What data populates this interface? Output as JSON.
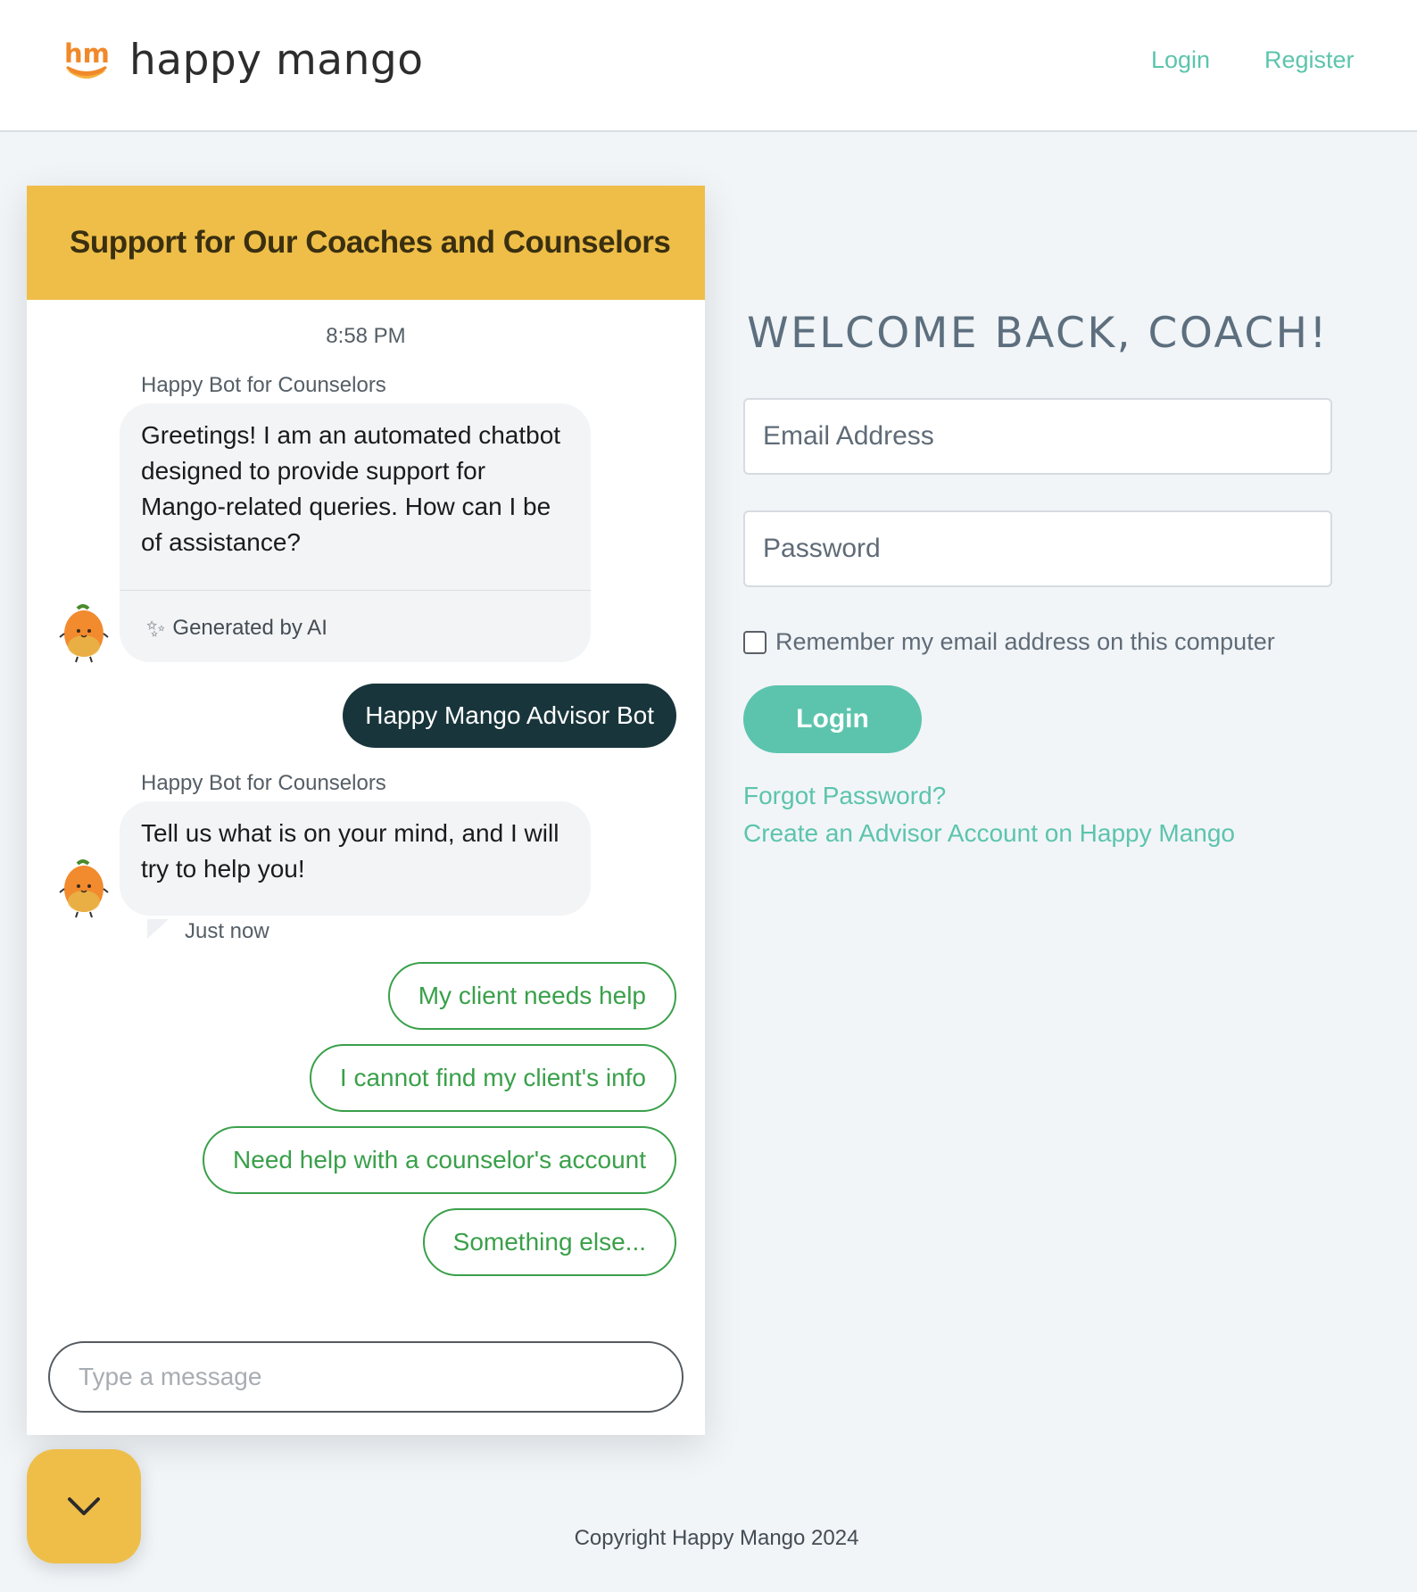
{
  "header": {
    "brand_name": "happy mango",
    "logo_initials": "hm",
    "nav": {
      "login": "Login",
      "register": "Register"
    }
  },
  "chat": {
    "title": "Support for Our Coaches and Counselors",
    "timestamp": "8:58 PM",
    "messages": [
      {
        "sender": "Happy Bot for Counselors",
        "text": "Greetings! I am an automated chatbot designed to provide support for Mango-related queries. How can I be of assistance?",
        "footer": "Generated by AI"
      },
      {
        "sender": "user",
        "text": "Happy Mango Advisor Bot"
      },
      {
        "sender": "Happy Bot for Counselors",
        "text": "Tell us what is on your mind, and I will try to help you!",
        "time": "Just now"
      }
    ],
    "quick_replies": [
      "My client needs help",
      "I cannot find my client's info",
      "Need help with a counselor's account",
      "Something else..."
    ],
    "input_placeholder": "Type a message"
  },
  "login": {
    "heading": "WELCOME BACK, COACH!",
    "email_placeholder": "Email Address",
    "password_placeholder": "Password",
    "remember_label": "Remember my email address on this computer",
    "button_label": "Login",
    "forgot_link": "Forgot Password?",
    "create_link": "Create an Advisor Account on Happy Mango"
  },
  "footer": {
    "copyright": "Copyright Happy Mango 2024"
  },
  "colors": {
    "accent_teal": "#5cc4ad",
    "chat_header_yellow": "#eebe48",
    "user_bubble": "#18353b",
    "quick_reply_green": "#3aa04a",
    "logo_orange": "#f0892a"
  },
  "icons": {
    "logo": "hm-logo-icon",
    "sparkle": "sparkle-icon",
    "avatar": "mango-avatar-icon",
    "collapse": "chevron-down-icon"
  }
}
